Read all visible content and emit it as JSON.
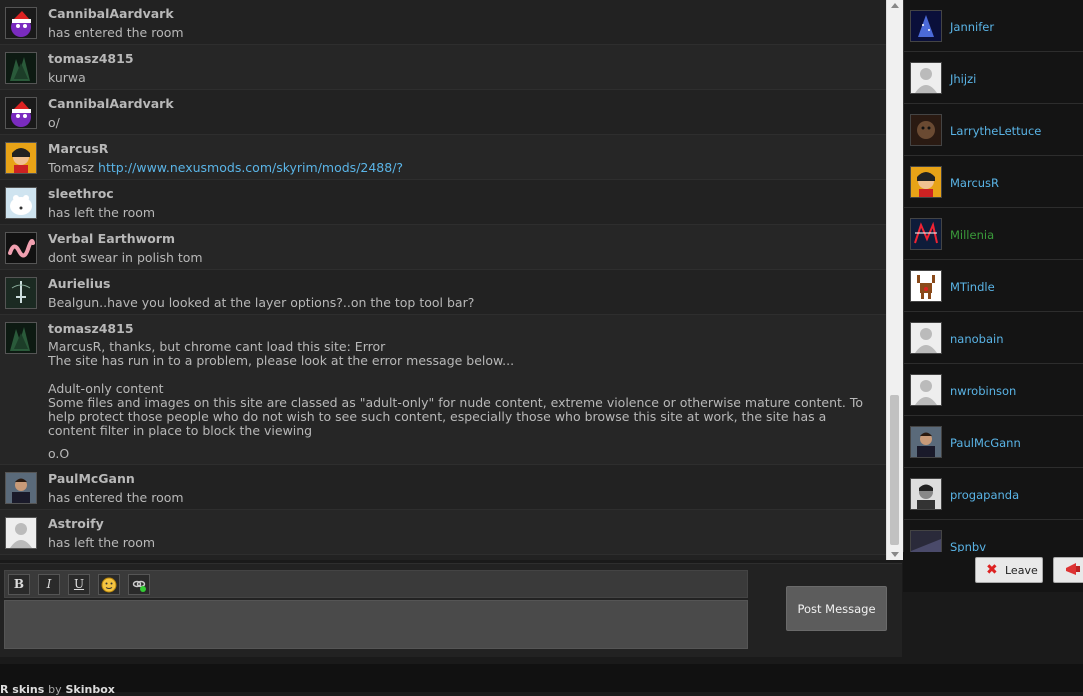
{
  "messages": [
    {
      "user": "CannibalAardvark",
      "text": "has entered the room",
      "avatar": "purple-santa-avatar"
    },
    {
      "user": "tomasz4815",
      "text": "kurwa",
      "avatar": "dark-tree-avatar"
    },
    {
      "user": "CannibalAardvark",
      "text": "o/",
      "avatar": "purple-santa-avatar"
    },
    {
      "user": "MarcusR",
      "text": "Tomasz ",
      "link": "http://www.nexusmods.com/skyrim/mods/2488/?",
      "avatar": "cartoon-face-avatar"
    },
    {
      "user": "sleethroc",
      "text": "has left the room",
      "avatar": "polar-bear-avatar"
    },
    {
      "user": "Verbal Earthworm",
      "text": "dont swear in polish tom",
      "avatar": "worm-avatar"
    },
    {
      "user": "Aurielius",
      "text": "Bealgun..have you looked at the layer options?..on the top tool bar?",
      "avatar": "sword-emblem-avatar"
    },
    {
      "user": "tomasz4815",
      "text": "MarcusR, thanks, but chrome cant load this site: Error\nThe site has run in to a problem, please look at the error message below...\n\nAdult-only content\nSome files and images on this site are classed as \"adult-only\" for nude content, extreme violence or otherwise mature content. To help protect those people who do not wish to see such content, especially those who browse this site at work, the site has a content filter in place to block the viewing",
      "text2": "o.O",
      "avatar": "dark-tree-avatar"
    },
    {
      "user": "PaulMcGann",
      "text": "has entered the room",
      "avatar": "man-photo-avatar"
    },
    {
      "user": "Astroify",
      "text": "has left the room",
      "avatar": "default-avatar"
    }
  ],
  "users": [
    {
      "name": "Jannifer",
      "avatar": "blue-tree-avatar",
      "role": "member"
    },
    {
      "name": "Jhijzi",
      "avatar": "default-avatar",
      "role": "member"
    },
    {
      "name": "LarrytheLettuce",
      "avatar": "dark-face-avatar",
      "role": "member"
    },
    {
      "name": "MarcusR",
      "avatar": "cartoon-face-avatar",
      "role": "member"
    },
    {
      "name": "Millenia",
      "avatar": "nms-logo-avatar",
      "role": "moderator"
    },
    {
      "name": "MTindle",
      "avatar": "reindeer-avatar",
      "role": "member"
    },
    {
      "name": "nanobain",
      "avatar": "default-avatar",
      "role": "member"
    },
    {
      "name": "nwrobinson",
      "avatar": "default-avatar",
      "role": "member"
    },
    {
      "name": "PaulMcGann",
      "avatar": "man-photo-avatar",
      "role": "member"
    },
    {
      "name": "progapanda",
      "avatar": "bw-portrait-avatar",
      "role": "member"
    },
    {
      "name": "Spnbv",
      "avatar": "dark-avatar",
      "role": "member"
    }
  ],
  "actions": {
    "leave_label": "Leave",
    "post_label": "Post Message"
  },
  "toolbar": {
    "bold": "B",
    "italic": "I",
    "underline": "U"
  },
  "footer": {
    "brand": "R skins",
    "by": "by",
    "author": "Skinbox"
  },
  "colors": {
    "link": "#5ab4e6",
    "moderator": "#3a9a3a",
    "background": "#222222"
  }
}
